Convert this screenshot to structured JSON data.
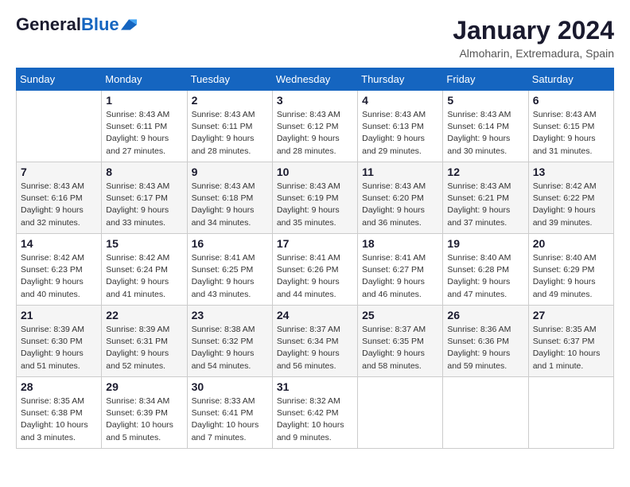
{
  "header": {
    "logo_general": "General",
    "logo_blue": "Blue",
    "month_title": "January 2024",
    "location": "Almoharin, Extremadura, Spain"
  },
  "days_of_week": [
    "Sunday",
    "Monday",
    "Tuesday",
    "Wednesday",
    "Thursday",
    "Friday",
    "Saturday"
  ],
  "weeks": [
    [
      {
        "day": "",
        "sunrise": "",
        "sunset": "",
        "daylight": ""
      },
      {
        "day": "1",
        "sunrise": "Sunrise: 8:43 AM",
        "sunset": "Sunset: 6:11 PM",
        "daylight": "Daylight: 9 hours and 27 minutes."
      },
      {
        "day": "2",
        "sunrise": "Sunrise: 8:43 AM",
        "sunset": "Sunset: 6:11 PM",
        "daylight": "Daylight: 9 hours and 28 minutes."
      },
      {
        "day": "3",
        "sunrise": "Sunrise: 8:43 AM",
        "sunset": "Sunset: 6:12 PM",
        "daylight": "Daylight: 9 hours and 28 minutes."
      },
      {
        "day": "4",
        "sunrise": "Sunrise: 8:43 AM",
        "sunset": "Sunset: 6:13 PM",
        "daylight": "Daylight: 9 hours and 29 minutes."
      },
      {
        "day": "5",
        "sunrise": "Sunrise: 8:43 AM",
        "sunset": "Sunset: 6:14 PM",
        "daylight": "Daylight: 9 hours and 30 minutes."
      },
      {
        "day": "6",
        "sunrise": "Sunrise: 8:43 AM",
        "sunset": "Sunset: 6:15 PM",
        "daylight": "Daylight: 9 hours and 31 minutes."
      }
    ],
    [
      {
        "day": "7",
        "sunrise": "Sunrise: 8:43 AM",
        "sunset": "Sunset: 6:16 PM",
        "daylight": "Daylight: 9 hours and 32 minutes."
      },
      {
        "day": "8",
        "sunrise": "Sunrise: 8:43 AM",
        "sunset": "Sunset: 6:17 PM",
        "daylight": "Daylight: 9 hours and 33 minutes."
      },
      {
        "day": "9",
        "sunrise": "Sunrise: 8:43 AM",
        "sunset": "Sunset: 6:18 PM",
        "daylight": "Daylight: 9 hours and 34 minutes."
      },
      {
        "day": "10",
        "sunrise": "Sunrise: 8:43 AM",
        "sunset": "Sunset: 6:19 PM",
        "daylight": "Daylight: 9 hours and 35 minutes."
      },
      {
        "day": "11",
        "sunrise": "Sunrise: 8:43 AM",
        "sunset": "Sunset: 6:20 PM",
        "daylight": "Daylight: 9 hours and 36 minutes."
      },
      {
        "day": "12",
        "sunrise": "Sunrise: 8:43 AM",
        "sunset": "Sunset: 6:21 PM",
        "daylight": "Daylight: 9 hours and 37 minutes."
      },
      {
        "day": "13",
        "sunrise": "Sunrise: 8:42 AM",
        "sunset": "Sunset: 6:22 PM",
        "daylight": "Daylight: 9 hours and 39 minutes."
      }
    ],
    [
      {
        "day": "14",
        "sunrise": "Sunrise: 8:42 AM",
        "sunset": "Sunset: 6:23 PM",
        "daylight": "Daylight: 9 hours and 40 minutes."
      },
      {
        "day": "15",
        "sunrise": "Sunrise: 8:42 AM",
        "sunset": "Sunset: 6:24 PM",
        "daylight": "Daylight: 9 hours and 41 minutes."
      },
      {
        "day": "16",
        "sunrise": "Sunrise: 8:41 AM",
        "sunset": "Sunset: 6:25 PM",
        "daylight": "Daylight: 9 hours and 43 minutes."
      },
      {
        "day": "17",
        "sunrise": "Sunrise: 8:41 AM",
        "sunset": "Sunset: 6:26 PM",
        "daylight": "Daylight: 9 hours and 44 minutes."
      },
      {
        "day": "18",
        "sunrise": "Sunrise: 8:41 AM",
        "sunset": "Sunset: 6:27 PM",
        "daylight": "Daylight: 9 hours and 46 minutes."
      },
      {
        "day": "19",
        "sunrise": "Sunrise: 8:40 AM",
        "sunset": "Sunset: 6:28 PM",
        "daylight": "Daylight: 9 hours and 47 minutes."
      },
      {
        "day": "20",
        "sunrise": "Sunrise: 8:40 AM",
        "sunset": "Sunset: 6:29 PM",
        "daylight": "Daylight: 9 hours and 49 minutes."
      }
    ],
    [
      {
        "day": "21",
        "sunrise": "Sunrise: 8:39 AM",
        "sunset": "Sunset: 6:30 PM",
        "daylight": "Daylight: 9 hours and 51 minutes."
      },
      {
        "day": "22",
        "sunrise": "Sunrise: 8:39 AM",
        "sunset": "Sunset: 6:31 PM",
        "daylight": "Daylight: 9 hours and 52 minutes."
      },
      {
        "day": "23",
        "sunrise": "Sunrise: 8:38 AM",
        "sunset": "Sunset: 6:32 PM",
        "daylight": "Daylight: 9 hours and 54 minutes."
      },
      {
        "day": "24",
        "sunrise": "Sunrise: 8:37 AM",
        "sunset": "Sunset: 6:34 PM",
        "daylight": "Daylight: 9 hours and 56 minutes."
      },
      {
        "day": "25",
        "sunrise": "Sunrise: 8:37 AM",
        "sunset": "Sunset: 6:35 PM",
        "daylight": "Daylight: 9 hours and 58 minutes."
      },
      {
        "day": "26",
        "sunrise": "Sunrise: 8:36 AM",
        "sunset": "Sunset: 6:36 PM",
        "daylight": "Daylight: 9 hours and 59 minutes."
      },
      {
        "day": "27",
        "sunrise": "Sunrise: 8:35 AM",
        "sunset": "Sunset: 6:37 PM",
        "daylight": "Daylight: 10 hours and 1 minute."
      }
    ],
    [
      {
        "day": "28",
        "sunrise": "Sunrise: 8:35 AM",
        "sunset": "Sunset: 6:38 PM",
        "daylight": "Daylight: 10 hours and 3 minutes."
      },
      {
        "day": "29",
        "sunrise": "Sunrise: 8:34 AM",
        "sunset": "Sunset: 6:39 PM",
        "daylight": "Daylight: 10 hours and 5 minutes."
      },
      {
        "day": "30",
        "sunrise": "Sunrise: 8:33 AM",
        "sunset": "Sunset: 6:41 PM",
        "daylight": "Daylight: 10 hours and 7 minutes."
      },
      {
        "day": "31",
        "sunrise": "Sunrise: 8:32 AM",
        "sunset": "Sunset: 6:42 PM",
        "daylight": "Daylight: 10 hours and 9 minutes."
      },
      {
        "day": "",
        "sunrise": "",
        "sunset": "",
        "daylight": ""
      },
      {
        "day": "",
        "sunrise": "",
        "sunset": "",
        "daylight": ""
      },
      {
        "day": "",
        "sunrise": "",
        "sunset": "",
        "daylight": ""
      }
    ]
  ]
}
